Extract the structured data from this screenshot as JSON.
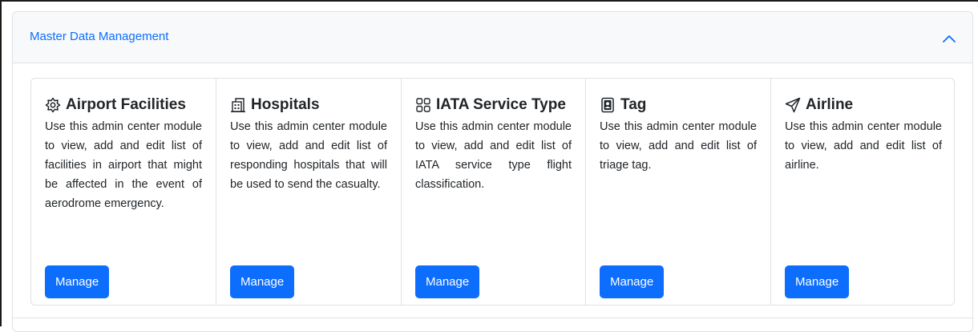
{
  "panel": {
    "title": "Master Data Management",
    "toggle_icon": "chevron-up-icon",
    "accent_color": "#0d6efd"
  },
  "cards": [
    {
      "title": "Airport Facilities",
      "icon": "gear-icon",
      "description": "Use this admin center module to view, add and edit list of facilities in airport that might be affected in the event of aerodrome emergency.",
      "button_label": "Manage"
    },
    {
      "title": "Hospitals",
      "icon": "building-icon",
      "description": "Use this admin center module to view, add and edit list of responding hospitals that will be used to send the casualty.",
      "button_label": "Manage"
    },
    {
      "title": "IATA Service Type",
      "icon": "grid-icon",
      "description": "Use this admin center module to view, add and edit list of IATA service type flight classification.",
      "button_label": "Manage"
    },
    {
      "title": "Tag",
      "icon": "badge-icon",
      "description": "Use this admin center module to view, add and edit list of triage tag.",
      "button_label": "Manage"
    },
    {
      "title": "Airline",
      "icon": "send-icon",
      "description": "Use this admin center module to view, add and edit list of airline.",
      "button_label": "Manage"
    }
  ]
}
